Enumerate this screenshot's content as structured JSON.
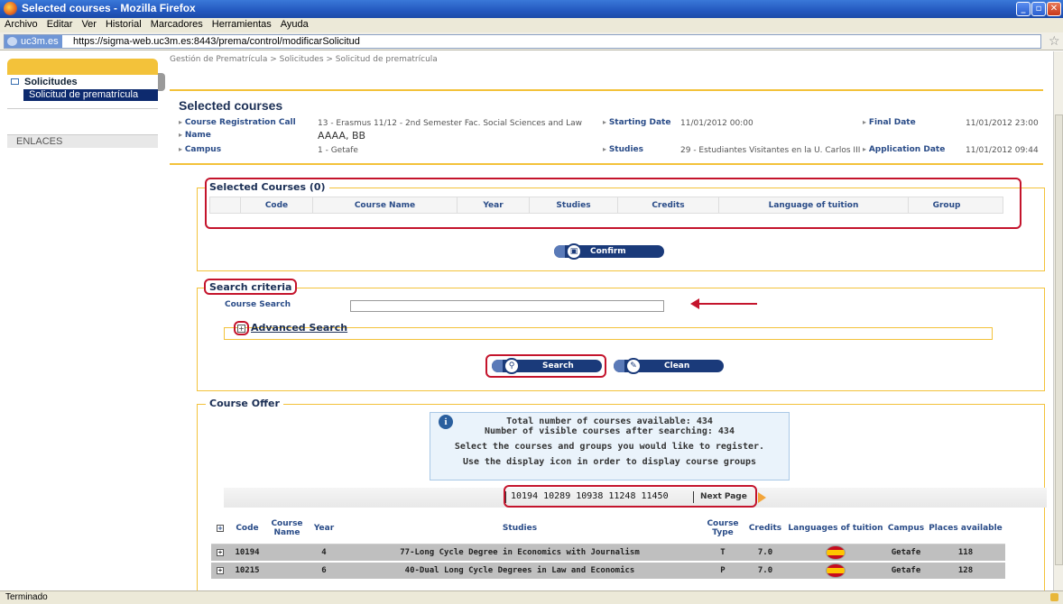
{
  "window": {
    "title": "Selected courses - Mozilla Firefox"
  },
  "menu": [
    "Archivo",
    "Editar",
    "Ver",
    "Historial",
    "Marcadores",
    "Herramientas",
    "Ayuda"
  ],
  "address": {
    "site": "uc3m.es",
    "url": "https://sigma-web.uc3m.es:8443/prema/control/modificarSolicitud"
  },
  "sidebar": {
    "section": "Solicitudes",
    "active_item": "Solicitud de prematrícula",
    "links": "ENLACES"
  },
  "breadcrumb": "Gestión de Prematrícula > Solicitudes > Solicitud de prematrícula",
  "header": {
    "title": "Selected courses",
    "call_label": "Course Registration Call",
    "call_value": "13 - Erasmus 11/12 - 2nd Semester Fac. Social Sciences and Law",
    "start_label": "Starting Date",
    "start_value": "11/01/2012 00:00",
    "final_label": "Final Date",
    "final_value": "11/01/2012 23:00",
    "name_label": "Name",
    "name_value": "AAAA, BB",
    "campus_label": "Campus",
    "campus_value": "1 - Getafe",
    "studies_label": "Studies",
    "studies_value": "29 - Estudiantes Visitantes en la U. Carlos III",
    "appdate_label": "Application Date",
    "appdate_value": "11/01/2012 09:44"
  },
  "selected": {
    "legend": "Selected Courses (0)",
    "columns": [
      "Code",
      "Course Name",
      "Year",
      "Studies",
      "Credits",
      "Language of tuition",
      "Group"
    ],
    "confirm_label": "Confirm"
  },
  "search": {
    "legend": "Search criteria",
    "course_search_label": "Course Search",
    "course_search_value": "",
    "advanced_label": "Advanced Search",
    "search_label": "Search",
    "clean_label": "Clean"
  },
  "offer": {
    "legend": "Course Offer",
    "info_total": "Total number of courses available: 434",
    "info_visible": "Number of visible courses after searching: 434",
    "info_select": "Select the courses and groups you would like to register.",
    "info_display": "Use the display icon in order to display course groups",
    "pages": "10194 10289 10938 11248 11450",
    "next_page": "Next Page",
    "columns": [
      "Code",
      "Course Name",
      "Year",
      "Studies",
      "Course Type",
      "Credits",
      "Languages of tuition",
      "Campus",
      "Places available"
    ],
    "rows": [
      {
        "code": "10194",
        "name": "",
        "year": "4",
        "studies": "77-Long Cycle Degree in Economics with Journalism",
        "type": "T",
        "credits": "7.0",
        "campus": "Getafe",
        "places": "118"
      },
      {
        "code": "10215",
        "name": "",
        "year": "6",
        "studies": "40-Dual Long Cycle Degrees in Law and Economics",
        "type": "P",
        "credits": "7.0",
        "campus": "Getafe",
        "places": "128"
      }
    ]
  },
  "status": "Terminado",
  "colors": {
    "accent": "#f3c23a",
    "navy": "#1a3a7a",
    "highlight": "#c4142c"
  }
}
